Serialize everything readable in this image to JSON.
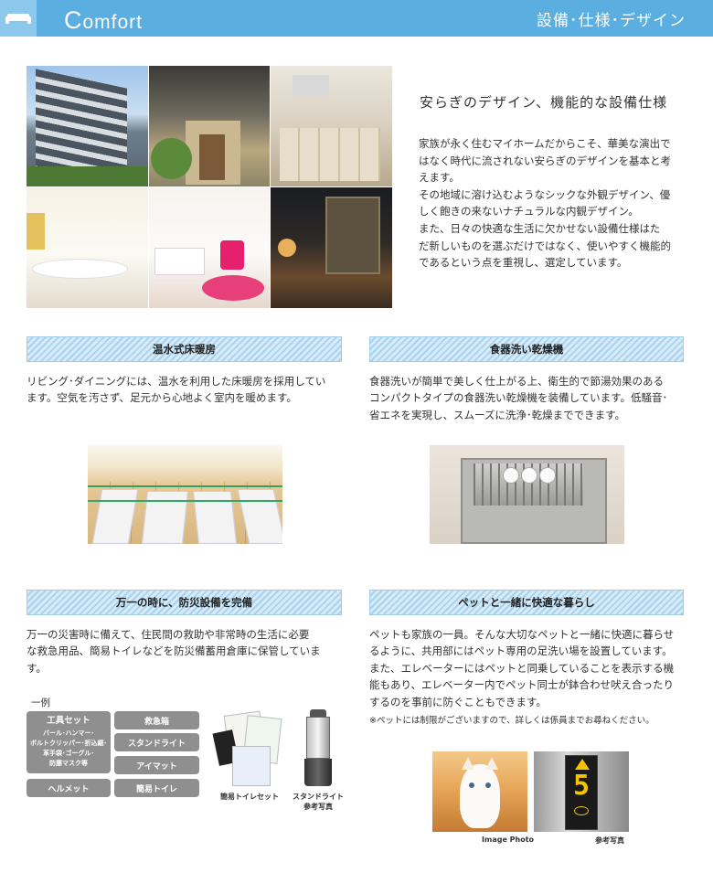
{
  "header": {
    "title_cap": "C",
    "title_rest": "omfort",
    "section": "設備･仕様･デザイン"
  },
  "intro": {
    "title": "安らぎのデザイン、機能的な設備仕様",
    "lines": [
      "家族が永く住むマイホームだからこそ、華美な演出で",
      "はなく時代に流されない安らぎのデザインを基本と考",
      "えます。",
      "その地域に溶け込むようなシックな外観デザイン、優",
      "しく飽きの来ないナチュラルな内観デザイン。",
      "また、日々の快適な生活に欠かせない設備仕様はた",
      "だ新しいものを選ぶだけではなく、使いやすく機能的",
      "であるという点を重視し、選定しています。"
    ]
  },
  "floor_heating": {
    "heading": "温水式床暖房",
    "lines": [
      "リビング･ダイニングには、温水を利用した床暖房を採用してい",
      "ます。空気を汚さず、足元から心地よく室内を暖めます。"
    ]
  },
  "dishwasher": {
    "heading": "食器洗い乾燥機",
    "lines": [
      "食器洗いが簡単で美しく仕上がる上、衛生的で節湯効果のある",
      "コンパクトタイプの食器洗い乾燥機を装備しています。低騒音･",
      "省エネを実現し、スムーズに洗浄･乾燥までできます。"
    ]
  },
  "disaster": {
    "heading": "万一の時に、防災設備を完備",
    "lines": [
      "万一の災害時に備えて、住民間の救助や非常時の生活に必要",
      "な救急用品、簡易トイレなどを防災備蓄用倉庫に保管していま",
      "す。"
    ],
    "example_label": "一例",
    "kit_title": "工具セット",
    "kit_detail": [
      "バール･ハンマー･",
      "ボルトクリッパー･折込鋸･",
      "革手袋･ゴーグル･",
      "防塵マスク等"
    ],
    "helmet": "ヘルメット",
    "first_aid": "救急箱",
    "stand_light": "スタンドライト",
    "eye_mask": "アイマット",
    "simple_toilet": "簡易トイレ",
    "toilet_set_caption": "簡易トイレセット",
    "light_caption_1": "スタンドライト",
    "light_caption_2": "参考写真"
  },
  "pet": {
    "heading": "ペットと一緒に快適な暮らし",
    "lines": [
      "ペットも家族の一員。そんな大切なペットと一緒に快適に暮らせ",
      "るように、共用部にはペット専用の足洗い場を設置しています。",
      "また、エレベーターにはペットと同乗していることを表示する機",
      "能もあり、エレベーター内でペット同士が鉢合わせ吠え合ったり",
      "するのを事前に防ぐこともできます。"
    ],
    "note": "※ペットには制限がございますので、詳しくは係員までお尋ねください。",
    "photo_caption_1": "Image Photo",
    "photo_caption_2": "参考写真",
    "elevator_number": "5"
  },
  "colors": {
    "header_bg": "#5aaee0",
    "bar_stripe": "#a8d2ee",
    "pill_bg": "#8f8f8f",
    "accent_yellow": "#f5c400"
  }
}
